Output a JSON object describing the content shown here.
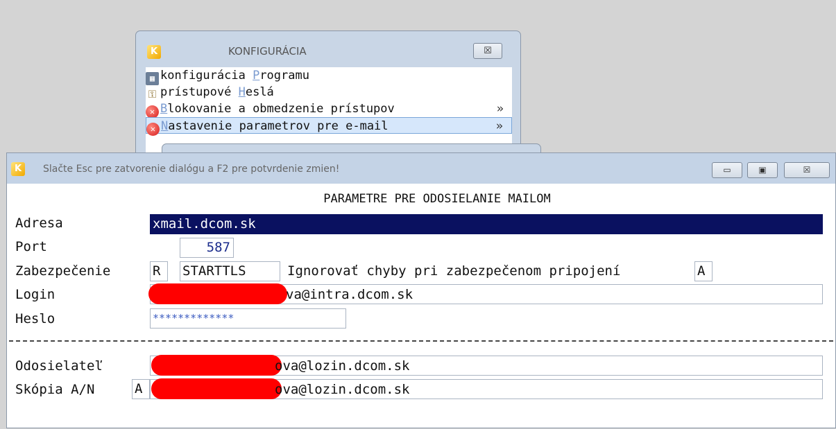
{
  "config_window": {
    "title": "KONFIGURÁCIA",
    "close_glyph": "☒",
    "icon_letter": "K",
    "menu": [
      {
        "pre": "konfigurácia ",
        "hot": "P",
        "post": "rogramu",
        "arrow": "",
        "icon": "program-icon"
      },
      {
        "pre": "prístupové ",
        "hot": "H",
        "post": "eslá",
        "arrow": "",
        "icon": "keys-icon"
      },
      {
        "pre": "",
        "hot": "B",
        "post": "lokovanie a obmedzenie prístupov",
        "arrow": "»",
        "icon": "error-icon"
      },
      {
        "pre": "",
        "hot": "N",
        "post": "astavenie parametrov pre e-mail",
        "arrow": "»",
        "icon": "error-icon",
        "selected": true
      }
    ]
  },
  "dialog": {
    "title": "Slačte Esc pre zatvorenie dialógu a F2 pre potvrdenie zmien!",
    "icon_letter": "K",
    "min_glyph": "▭",
    "max_glyph": "▣",
    "close_glyph": "☒",
    "heading": "PARAMETRE PRE ODOSIELANIE MAILOM",
    "fields": {
      "adresa_label": "Adresa",
      "adresa_value": "xmail.dcom.sk",
      "port_label": "Port",
      "port_value": "587",
      "zabezpecenie_label": "Zabezpečenie",
      "zabezpecenie_code": "R",
      "zabezpecenie_value": "STARTTLS",
      "ignore_label": "Ignorovať chyby pri zabezpečenom pripojení",
      "ignore_value": "A",
      "login_label": "Login",
      "login_value_suffix": "va@intra.dcom.sk",
      "heslo_label": "Heslo",
      "heslo_value": "*************",
      "odosielatel_label": "Odosielateľ",
      "odosielatel_value_suffix": "ova@lozin.dcom.sk",
      "skopia_label": "Skópia A/N",
      "skopia_flag": "A",
      "skopia_value_suffix": "ova@lozin.dcom.sk"
    }
  },
  "colors": {
    "highlight_bg": "#0a1160",
    "redaction": "#ff0000",
    "window_frame": "#c4d3e6"
  }
}
